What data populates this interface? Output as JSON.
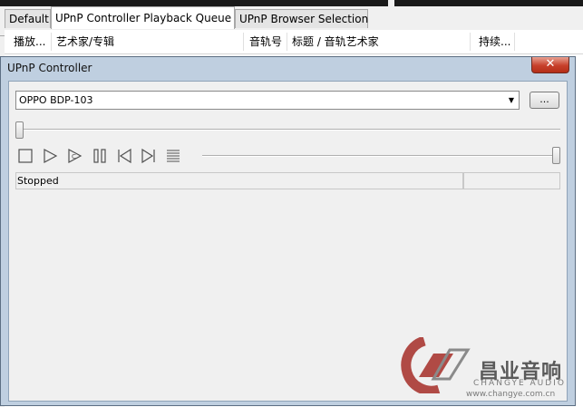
{
  "tabs": [
    {
      "label": "Default"
    },
    {
      "label": "UPnP Controller Playback Queue"
    },
    {
      "label": "UPnP Browser Selection"
    }
  ],
  "columns": [
    "播放...",
    "艺术家/专辑",
    "音轨号",
    "标题 / 音轨艺术家",
    "持续..."
  ],
  "dialog": {
    "title": "UPnP Controller",
    "close_icon": "close-icon"
  },
  "renderer": {
    "selected": "OPPO BDP-103",
    "browse_label": "..."
  },
  "transport": {
    "icons": [
      "stop-icon",
      "play-icon",
      "play-from-cursor-icon",
      "pause-icon",
      "previous-icon",
      "next-icon",
      "playlist-icon"
    ]
  },
  "status": {
    "state": "Stopped",
    "time": ""
  },
  "watermark": {
    "brand": "昌业音响",
    "sub": "CHANGYE AUDIO",
    "url": "www.changye.com.cn"
  }
}
